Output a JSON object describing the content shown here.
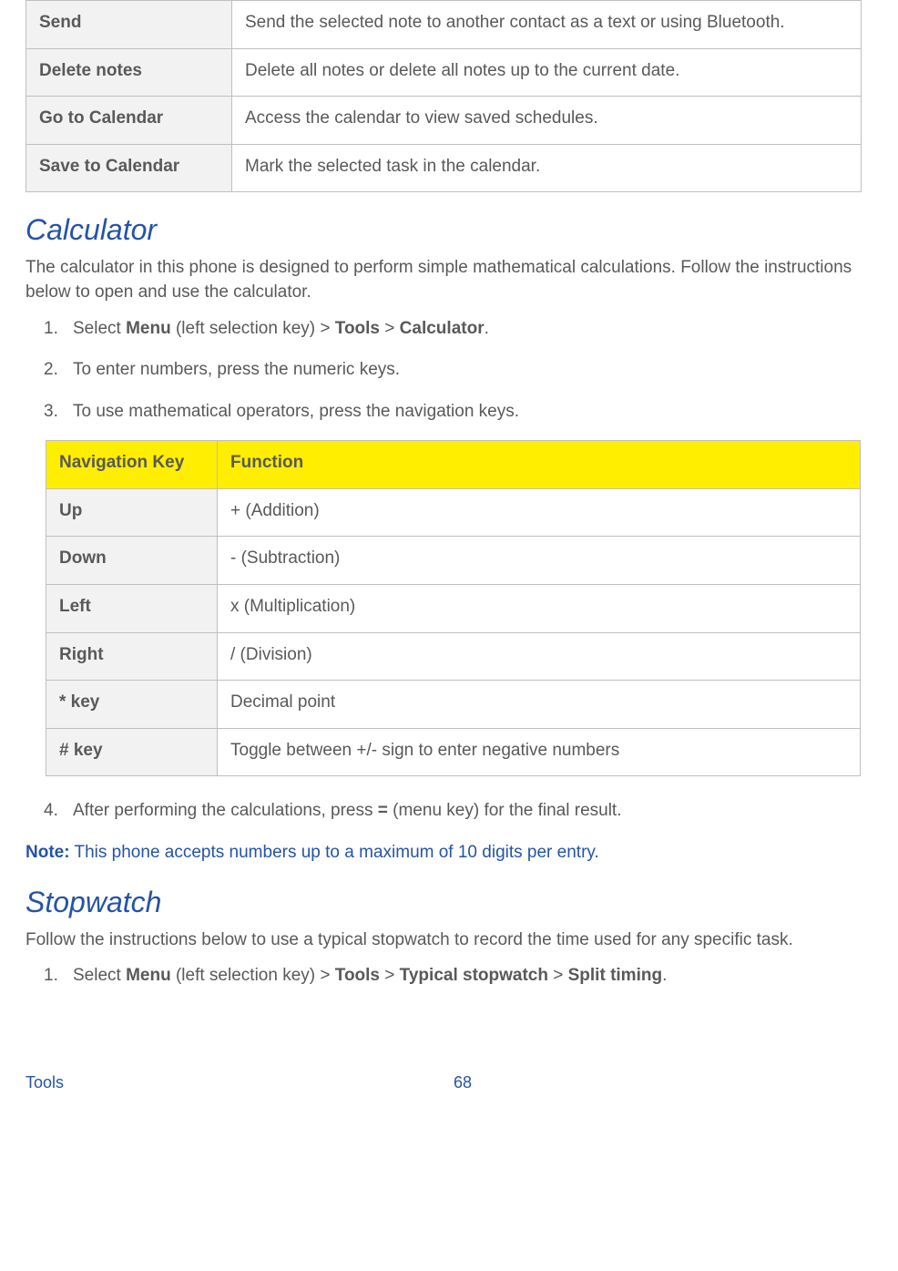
{
  "table1": {
    "rows": [
      {
        "label": "Send",
        "desc": "Send the selected note to another contact as a text or using Bluetooth."
      },
      {
        "label": "Delete notes",
        "desc": "Delete all notes or delete all notes up to the current date."
      },
      {
        "label": "Go to Calendar",
        "desc": "Access the calendar to view saved schedules."
      },
      {
        "label": "Save to Calendar",
        "desc": "Mark the selected task in the calendar."
      }
    ]
  },
  "calculator": {
    "heading": "Calculator",
    "intro": "The calculator in this phone is designed to perform simple mathematical calculations. Follow the instructions below to open and use the calculator.",
    "step1_a": "Select ",
    "step1_menu": "Menu",
    "step1_b": " (left selection key) > ",
    "step1_tools": "Tools",
    "step1_c": " > ",
    "step1_calc": "Calculator",
    "step1_d": ".",
    "step2": "To enter numbers, press the numeric keys.",
    "step3": "To use mathematical operators, press the navigation keys.",
    "table_header_key": "Navigation Key",
    "table_header_func": "Function",
    "rows": [
      {
        "key": "Up",
        "func": "+ (Addition)"
      },
      {
        "key": "Down",
        "func": "- (Subtraction)"
      },
      {
        "key": "Left",
        "func": "x (Multiplication)"
      },
      {
        "key": "Right",
        "func": "/ (Division)"
      },
      {
        "key": "* key",
        "func": "Decimal point"
      },
      {
        "key": "# key",
        "func": "Toggle between +/- sign to enter negative numbers"
      }
    ],
    "step4_a": "After performing the calculations, press ",
    "step4_eq": "=",
    "step4_b": " (menu key) for the final result.",
    "note_label": "Note:",
    "note_text": " This phone accepts numbers up to a maximum of 10 digits per entry."
  },
  "stopwatch": {
    "heading": "Stopwatch",
    "intro": "Follow the instructions below to use a typical stopwatch to record the time used for any specific task.",
    "step1_a": "Select ",
    "step1_menu": "Menu",
    "step1_b": " (left selection key) > ",
    "step1_tools": "Tools",
    "step1_c": " > ",
    "step1_tsw": "Typical stopwatch",
    "step1_d": " > ",
    "step1_split": "Split timing",
    "step1_e": "."
  },
  "footer": {
    "section": "Tools",
    "page": "68"
  }
}
